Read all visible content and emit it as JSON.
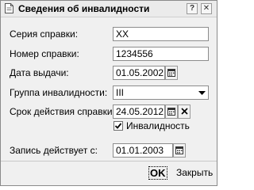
{
  "window": {
    "title": "Сведения об инвалидности",
    "help_glyph": "?",
    "close_glyph": "✕"
  },
  "form": {
    "series": {
      "label": "Серия справки:",
      "value": "ХХ"
    },
    "number": {
      "label": "Номер справки:",
      "value": "1234556"
    },
    "issue_date": {
      "label": "Дата выдачи:",
      "value": "01.05.2002"
    },
    "disability_group": {
      "label": "Группа инвалидности:",
      "value": "III"
    },
    "valid_until": {
      "label": "Срок действия справки:",
      "value": "24.05.2012"
    },
    "disability_checkbox": {
      "label": "Инвалидность",
      "checked": true
    },
    "record_valid_from": {
      "label": "Запись действует с:",
      "value": "01.01.2003"
    }
  },
  "footer": {
    "ok_label": "OK",
    "close_label": "Закрыть"
  },
  "colors": {
    "title_bar": "#ebebeb",
    "window_bg": "#f0f0f0",
    "border": "#8c8c8c"
  },
  "icons": [
    "document-icon",
    "help-icon",
    "close-icon",
    "calendar-icon",
    "dropdown-arrow-icon",
    "clear-icon",
    "checkmark-icon"
  ]
}
